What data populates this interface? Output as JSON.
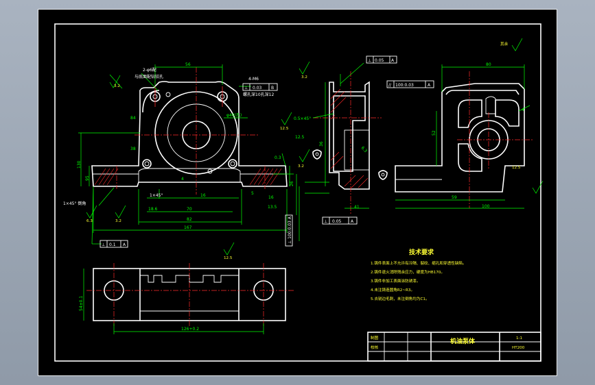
{
  "dims": {
    "top_width": "56",
    "hole_spec": "2-φ6配",
    "hole_spec2": "与底面配钻铰孔",
    "thread_spec": "4-M6",
    "thread_depth": "螺孔深10孔深12",
    "width_84": "84",
    "height_38": "38",
    "dia_bore": "φ40(孔)",
    "dim_130": "130",
    "dim_95": "95",
    "dim_16": "16",
    "dim_4": "4",
    "dim_5": "5",
    "dim_1_45": "1×45°",
    "dim_18_6": "18.6",
    "dim_70": "70",
    "dim_82": "82",
    "dim_167": "167",
    "dim_16_0": "16",
    "dim_0_3": "0.3",
    "dim_13_5": "13.5",
    "dim_26": "26",
    "dim_3_2": "3.2",
    "dim_1x45_rr": "1×45° 倒角",
    "right_dim_80": "80",
    "right_dim_59": "59",
    "right_dim_100": "100",
    "right_dim_52": "52",
    "right_dim_4": "4",
    "side_dim_41": "41",
    "side_dim_36": "36",
    "side_dim_6_3": "6.3",
    "side_dim_12_5": "12.5",
    "side_chamfer": "0.5×45°",
    "bottom_dim_1": "126+0.2",
    "bottom_dim_2": "54±0.1"
  },
  "tolerance_frames": {
    "top_side": {
      "sym": "⊥",
      "tol": "0.05",
      "datum": "A"
    },
    "top_side_right": {
      "sym": "//",
      "tol": "100:0.03",
      "datum": "A"
    },
    "top_front": {
      "sym": "⊥",
      "tol": "0.03",
      "datum": "B"
    },
    "mid_side": {
      "sym": "⊥",
      "tol": "0.05",
      "datum": "A"
    },
    "left_bottom": {
      "sym": "⊥",
      "tol": "0.1",
      "datum": "A"
    },
    "vert_tol": "⊥ 100:0.03 A"
  },
  "roughness": {
    "surface_note": "其余",
    "values": [
      "3.2",
      "12.5",
      "3.2",
      "6.3",
      "12.5",
      "3.2",
      "12.5",
      "3.2"
    ]
  },
  "tech_requirements": {
    "title": "技术要求",
    "items": [
      "1.铸件表面上不允许有冷隔、裂纹、缩孔和穿透性缺陷。",
      "2.铸件退火消除残余应力，硬度为HB170。",
      "3.铸件非加工表面涂防锈漆。",
      "4.未注铸造圆角R2~R3。",
      "5.去锐边毛刺，未注倒角均为C1。"
    ]
  },
  "title_block": {
    "row1_label": "制图",
    "row2_label": "校核",
    "part_name": "机油泵体",
    "scale": "1:1",
    "material": "HT200"
  }
}
